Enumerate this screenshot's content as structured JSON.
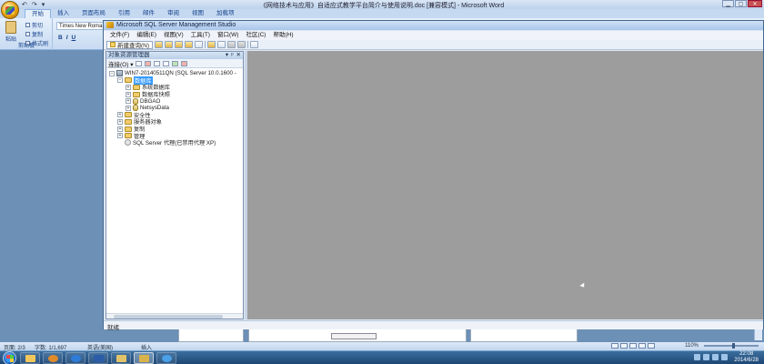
{
  "word": {
    "title": "《网络技术与应用》自适应式教学平台简介与使用说明.doc [兼容模式] - Microsoft Word",
    "quick_access": [
      "↶",
      "↷",
      "▾"
    ],
    "window_controls": [
      "▁",
      "▢",
      "✕"
    ],
    "tabs": [
      "开始",
      "插入",
      "页面布局",
      "引用",
      "邮件",
      "审阅",
      "视图",
      "加载项"
    ],
    "active_tab": "开始",
    "clipboard": {
      "paste": "粘贴",
      "cut": "剪切",
      "copy": "复制",
      "format_painter": "格式刷",
      "group": "剪贴板"
    },
    "font": {
      "name": "Times New Roman",
      "bold": "B",
      "italic": "I",
      "underline": "U"
    },
    "status": {
      "page": "页面: 2/3",
      "words": "字数: 1/1,697",
      "language": "英语(美国)",
      "mode": "插入",
      "zoom": "110%",
      "zoom_level": 0.55
    }
  },
  "ssms": {
    "title": "Microsoft SQL Server Management Studio",
    "menu": [
      "文件(F)",
      "编辑(E)",
      "视图(V)",
      "工具(T)",
      "窗口(W)",
      "社区(C)",
      "帮助(H)"
    ],
    "new_query": "新建查询(N)",
    "object_explorer": {
      "title": "对象资源管理器",
      "header_icons": [
        "▾",
        "ᵖ",
        "✕"
      ],
      "connect": "连接(O) ▾",
      "tree": {
        "server": "WIN7-20140511QN (SQL Server 10.0.1600 -",
        "databases": "数据库",
        "system_databases": "系统数据库",
        "snapshots": "数据库快照",
        "db1": "DBGAO",
        "db2": "NetsysData",
        "security": "安全性",
        "server_objects": "服务器对象",
        "replication": "复制",
        "management": "管理",
        "agent": "SQL Server 代理(已禁用代理 XP)"
      }
    },
    "status": "就绪"
  },
  "taskbar": {
    "time": "22:08",
    "date": "2014/6/28"
  },
  "colors": {
    "selection": "#3399ff",
    "doc_area": "#9d9d9d",
    "taskbar": "#1d4775"
  }
}
